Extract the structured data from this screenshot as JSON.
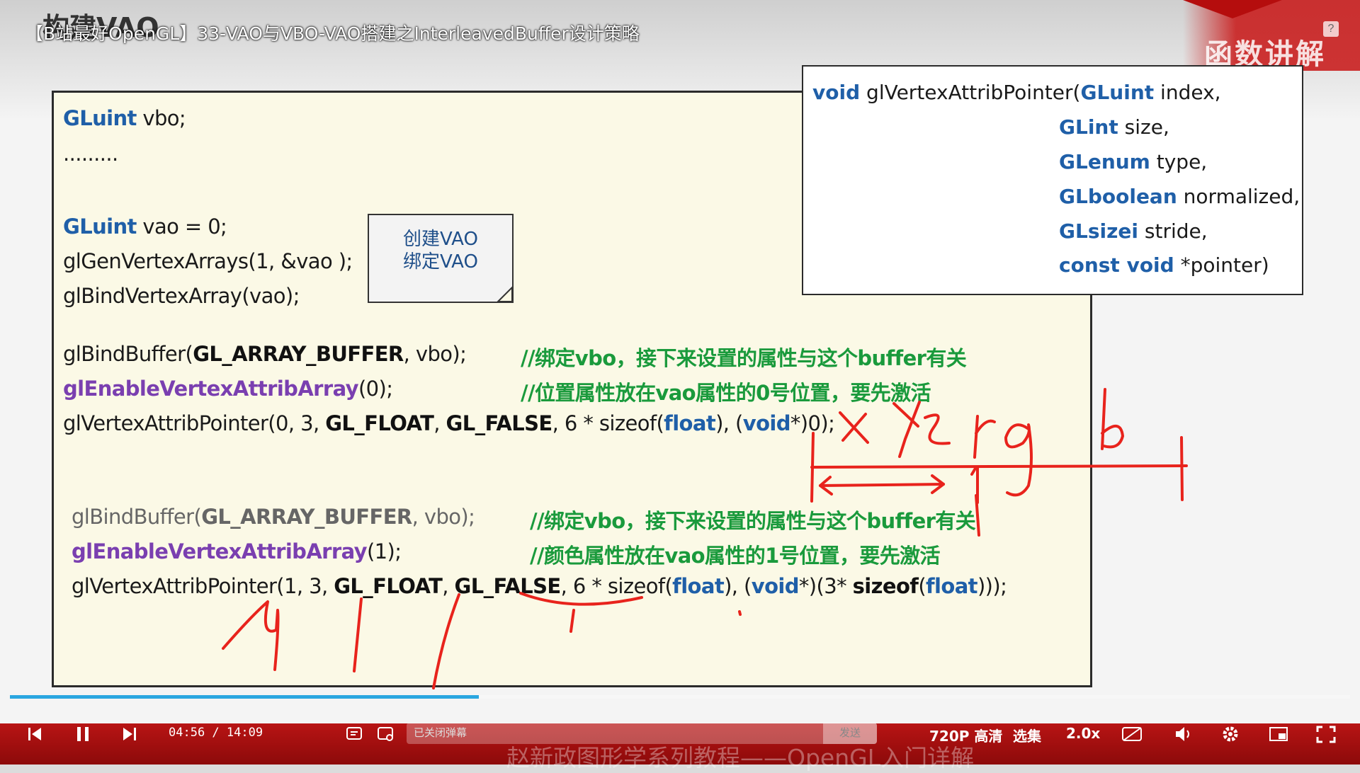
{
  "slide": {
    "heading": "构建VAO",
    "video_title": "【B站最好OpenGL】33-VAO与VBO-VAO搭建之InterleavedBuffer设计策略",
    "help": "?",
    "banner": "函数讲解"
  },
  "code": {
    "l1": {
      "kw": "GLuint",
      "rest": " vbo;"
    },
    "l2": ".........",
    "l3": {
      "kw": "GLuint",
      "rest": "  vao = 0;"
    },
    "l4": "glGenVertexArrays(1, &vao );",
    "l5": "glBindVertexArray(vao);",
    "l6": {
      "a": "glBindBuffer(",
      "b": "GL_ARRAY_BUFFER",
      "c": ", vbo);",
      "comment": "//绑定vbo，接下来设置的属性与这个buffer有关"
    },
    "l7": {
      "fn": "glEnableVertexAttribArray",
      "rest": "(0);",
      "comment": "//位置属性放在vao属性的0号位置，要先激活"
    },
    "l8": {
      "a": "glVertexAttribPointer(0, 3, ",
      "b": "GL_FLOAT",
      "c": ", ",
      "d": "GL_FALSE",
      "e": ", 6 * sizeof(",
      "f": "float",
      "g": "), (",
      "h": "void",
      "i": "*)0);"
    },
    "l9": {
      "a": "glBindBuffer(",
      "b": "GL_ARRAY_BUFFER",
      "c": ", vbo);",
      "comment": "//绑定vbo，接下来设置的属性与这个buffer有关"
    },
    "l10": {
      "fn": "glEnableVertexAttribArray",
      "rest": "(1);",
      "comment": "//颜色属性放在vao属性的1号位置，要先激活"
    },
    "l11": {
      "a": "glVertexAttribPointer(1, 3, ",
      "b": "GL_FLOAT",
      "c": ", ",
      "d": "GL_FALSE",
      "e": ", 6 * sizeof(",
      "f": "float",
      "g": "), (",
      "h": "void",
      "i": "*)(3* ",
      "j": "sizeof",
      "k": "(",
      "l": "float",
      "m": ")));"
    }
  },
  "note": {
    "line1": "创建VAO",
    "line2": "绑定VAO"
  },
  "signature": {
    "l1": {
      "kw": "void",
      "a": " glVertexAttribPointer(",
      "kw2": "GLuint",
      "b": " index,"
    },
    "l2": {
      "kw": "GLint",
      "b": " size,"
    },
    "l3": {
      "kw": "GLenum",
      "b": " type,"
    },
    "l4": {
      "kw": "GLboolean",
      "b": " normalized,"
    },
    "l5": {
      "kw": "GLsizei",
      "b": " stride,"
    },
    "l6": {
      "kw": "const void",
      "b": " *pointer)"
    }
  },
  "player": {
    "current_time": "04:56",
    "separator": " / ",
    "total_time": "14:09",
    "progress": 0.35,
    "danmaku_placeholder": "已关闭弹幕",
    "send_label": "发送",
    "quality": "720P 高清",
    "episodes": "选集",
    "speed": "2.0x",
    "subtitle": "赵新政图形学系列教程——OpenGL入门详解"
  },
  "colors": {
    "keyword": "#1f5fa8",
    "function": "#7a3fb0",
    "comment": "#1a9a3c",
    "ink": "#e8231c",
    "player_bar": "#b81414",
    "progress": "#2aa6e0"
  }
}
